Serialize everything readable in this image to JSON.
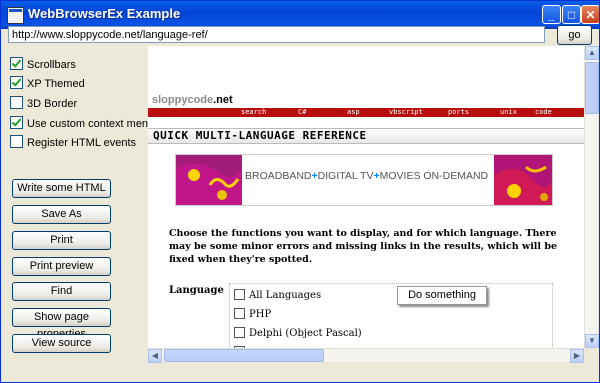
{
  "window": {
    "title": "WebBrowserEx Example",
    "minimize": "_",
    "maximize": "□",
    "close": "✕"
  },
  "address": {
    "url": "http://www.sloppycode.net/language-ref/",
    "go_label": "go"
  },
  "options": [
    {
      "label": "Scrollbars",
      "checked": true
    },
    {
      "label": "XP Themed",
      "checked": true
    },
    {
      "label": "3D Border",
      "checked": false
    },
    {
      "label": "Use custom context menu",
      "checked": true
    },
    {
      "label": "Register HTML events",
      "checked": false
    }
  ],
  "buttons": [
    "Write some HTML",
    "Save As",
    "Print",
    "Print preview",
    "Find",
    "Show page properties",
    "View source"
  ],
  "page": {
    "logo_prefix": "sloppycode",
    "logo_suffix": ".net",
    "nav": [
      "search",
      "C#",
      "asp",
      "vbscript",
      "ports",
      "unix",
      "code library"
    ],
    "heading": "QUICK MULTI-LANGUAGE REFERENCE",
    "banner": {
      "part1": "BROADBAND",
      "plus1": "+",
      "part2": "DIGITAL TV",
      "plus2": "+",
      "part3": "MOVIES ON-DEMAND"
    },
    "intro": "Choose the functions you want to display, and for which language. There may be some minor errors and missing links in the results, which will be fixed when they're spotted.",
    "language_label": "Language",
    "languages": [
      "All Languages",
      "PHP",
      "Delphi (Object Pascal)"
    ]
  },
  "context_menu": {
    "item": "Do something"
  }
}
